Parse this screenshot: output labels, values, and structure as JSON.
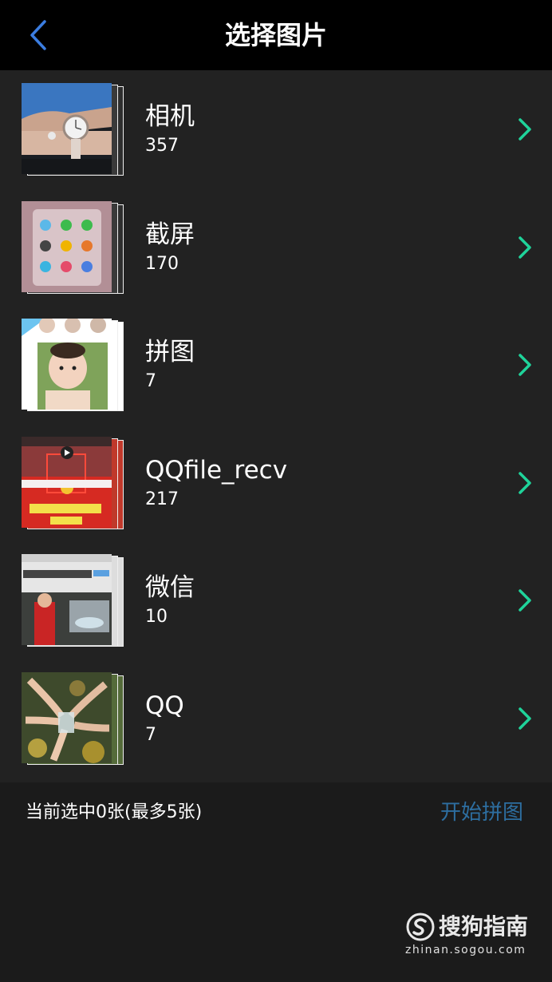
{
  "header": {
    "title": "选择图片"
  },
  "albums": [
    {
      "name": "相机",
      "count": "357",
      "thumb": "watch-photo-icon"
    },
    {
      "name": "截屏",
      "count": "170",
      "thumb": "screenshot-icon"
    },
    {
      "name": "拼图",
      "count": "7",
      "thumb": "baby-collage-icon"
    },
    {
      "name": "QQfile_recv",
      "count": "217",
      "thumb": "red-promo-icon"
    },
    {
      "name": "微信",
      "count": "10",
      "thumb": "article-photo-icon"
    },
    {
      "name": "QQ",
      "count": "7",
      "thumb": "toast-photo-icon"
    }
  ],
  "footer": {
    "selection_text": "当前选中0张(最多5张)",
    "start_label": "开始拼图"
  },
  "watermark": {
    "brand": "搜狗指南",
    "url": "zhinan.sogou.com"
  },
  "colors": {
    "accent_back": "#3b7de0",
    "chevron": "#1fd39a",
    "start_button": "#2d6ea0"
  }
}
